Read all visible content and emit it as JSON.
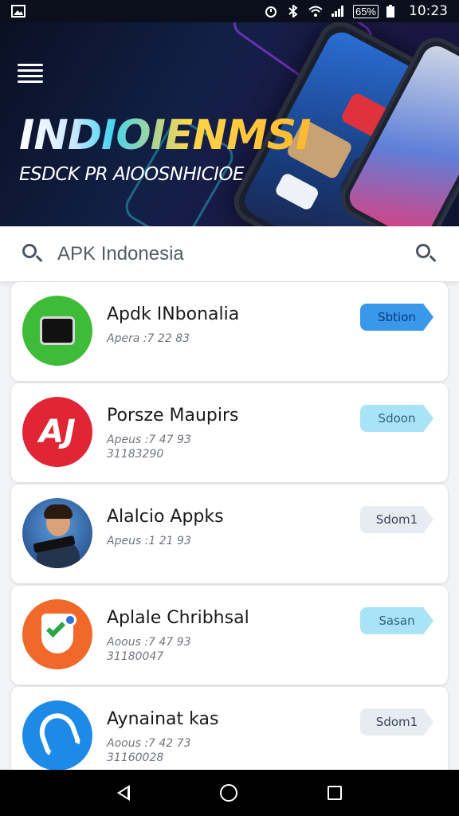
{
  "status_bar": {
    "battery_percent": "65%",
    "time": "10:23",
    "icons": [
      "image-icon",
      "alarm-icon",
      "bluetooth-icon",
      "wifi-icon",
      "signal-icon",
      "battery-icon"
    ]
  },
  "banner": {
    "title": "INDIOIENMSI",
    "subtitle": "ESDCK PR AIOOSNHICIOE"
  },
  "search": {
    "value": "APK Indonesia"
  },
  "apps": [
    {
      "name": "Apdk INbonalia",
      "meta1": "Apera :7 22 83",
      "meta2": "",
      "button": "Sbtion",
      "button_style": "blue"
    },
    {
      "name": "Porsze Maupirs",
      "meta1": "Apeus :7 47 93",
      "meta2": "31183290",
      "button": "Sdoon",
      "button_style": "cyan"
    },
    {
      "name": "Alalcio Appks",
      "meta1": "Apeus :1 21 93",
      "meta2": "",
      "button": "Sdom1",
      "button_style": "grey"
    },
    {
      "name": "Aplale Chribhsal",
      "meta1": "Aoous :7 47 93",
      "meta2": "31180047",
      "button": "Sasan",
      "button_style": "cyan"
    },
    {
      "name": "Aynainat kas",
      "meta1": "Aoous :7 42 73",
      "meta2": "31160028",
      "button": "Sdom1",
      "button_style": "grey"
    }
  ],
  "colors": {
    "accent_blue": "#3a98ea",
    "accent_cyan": "#a9e3f6",
    "banner_bg": "#122046"
  }
}
